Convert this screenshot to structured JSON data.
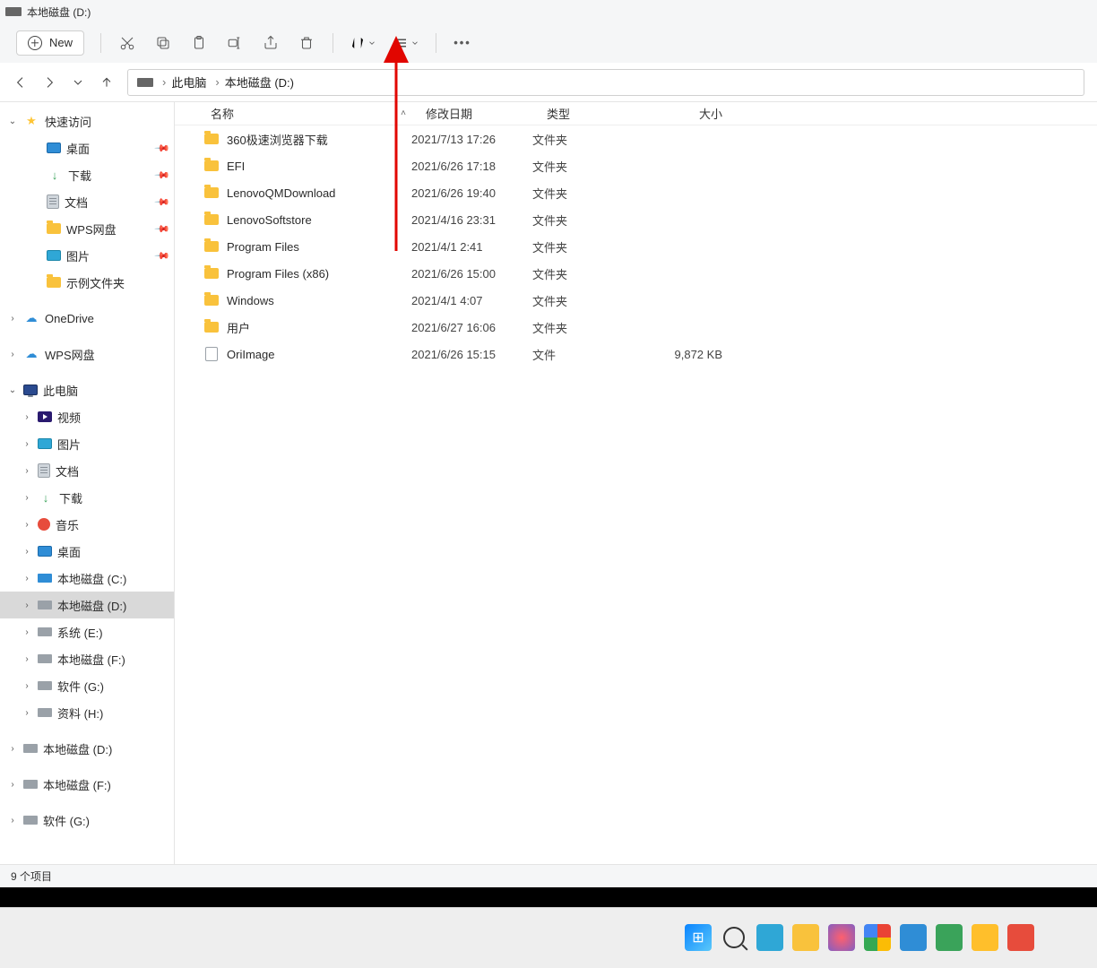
{
  "window": {
    "title": "本地磁盘 (D:)"
  },
  "commandbar": {
    "new_label": "New"
  },
  "breadcrumb": {
    "root": "此电脑",
    "current": "本地磁盘 (D:)"
  },
  "columns": {
    "name": "名称",
    "modified": "修改日期",
    "type": "类型",
    "size": "大小"
  },
  "sidebar": {
    "quick_access": "快速访问",
    "quick_items": [
      {
        "label": "桌面",
        "icon": "desktop",
        "pin": true
      },
      {
        "label": "下载",
        "icon": "download",
        "pin": true
      },
      {
        "label": "文档",
        "icon": "docs",
        "pin": true
      },
      {
        "label": "WPS网盘",
        "icon": "folder",
        "pin": true
      },
      {
        "label": "图片",
        "icon": "pic",
        "pin": true
      },
      {
        "label": "示例文件夹",
        "icon": "folder",
        "pin": false
      }
    ],
    "onedrive": "OneDrive",
    "wps": "WPS网盘",
    "this_pc": "此电脑",
    "pc_items": [
      {
        "label": "视频",
        "icon": "video"
      },
      {
        "label": "图片",
        "icon": "pic"
      },
      {
        "label": "文档",
        "icon": "docs"
      },
      {
        "label": "下载",
        "icon": "download"
      },
      {
        "label": "音乐",
        "icon": "music"
      },
      {
        "label": "桌面",
        "icon": "desktop"
      },
      {
        "label": "本地磁盘 (C:)",
        "icon": "disksys"
      },
      {
        "label": "本地磁盘 (D:)",
        "icon": "disk",
        "selected": true
      },
      {
        "label": "系统 (E:)",
        "icon": "disk"
      },
      {
        "label": "本地磁盘 (F:)",
        "icon": "disk"
      },
      {
        "label": "软件 (G:)",
        "icon": "disk"
      },
      {
        "label": "资料 (H:)",
        "icon": "disk"
      }
    ],
    "extra": [
      {
        "label": "本地磁盘 (D:)",
        "icon": "disk"
      },
      {
        "label": "本地磁盘 (F:)",
        "icon": "disk"
      },
      {
        "label": "软件 (G:)",
        "icon": "disk"
      }
    ]
  },
  "files": [
    {
      "name": "360极速浏览器下载",
      "modified": "2021/7/13 17:26",
      "type": "文件夹",
      "size": "",
      "kind": "folder"
    },
    {
      "name": "EFI",
      "modified": "2021/6/26 17:18",
      "type": "文件夹",
      "size": "",
      "kind": "folder"
    },
    {
      "name": "LenovoQMDownload",
      "modified": "2021/6/26 19:40",
      "type": "文件夹",
      "size": "",
      "kind": "folder"
    },
    {
      "name": "LenovoSoftstore",
      "modified": "2021/4/16 23:31",
      "type": "文件夹",
      "size": "",
      "kind": "folder"
    },
    {
      "name": "Program Files",
      "modified": "2021/4/1 2:41",
      "type": "文件夹",
      "size": "",
      "kind": "folder"
    },
    {
      "name": "Program Files (x86)",
      "modified": "2021/6/26 15:00",
      "type": "文件夹",
      "size": "",
      "kind": "folder"
    },
    {
      "name": "Windows",
      "modified": "2021/4/1 4:07",
      "type": "文件夹",
      "size": "",
      "kind": "folder"
    },
    {
      "name": "用户",
      "modified": "2021/6/27 16:06",
      "type": "文件夹",
      "size": "",
      "kind": "folder"
    },
    {
      "name": "OriImage",
      "modified": "2021/6/26 15:15",
      "type": "文件",
      "size": "9,872 KB",
      "kind": "file"
    }
  ],
  "status": {
    "items": "9 个项目"
  }
}
